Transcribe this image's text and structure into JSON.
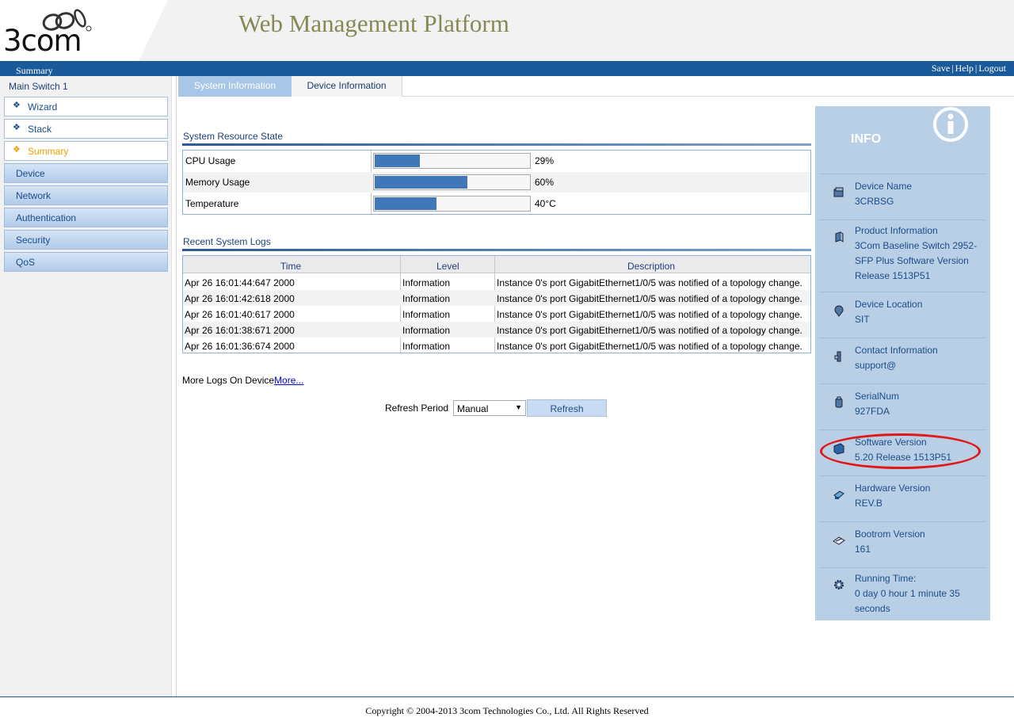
{
  "header": {
    "logo_text": "3com",
    "title": "Web Management Platform"
  },
  "topbar": {
    "breadcrumb": "Summary",
    "links": [
      "Save",
      "Help",
      "Logout"
    ]
  },
  "sidebar": {
    "title": "Main Switch 1",
    "items": [
      {
        "label": "Wizard",
        "style": "light"
      },
      {
        "label": "Stack",
        "style": "light"
      },
      {
        "label": "Summary",
        "style": "light",
        "active": true
      },
      {
        "label": "Device",
        "style": "blue"
      },
      {
        "label": "Network",
        "style": "blue"
      },
      {
        "label": "Authentication",
        "style": "blue"
      },
      {
        "label": "Security",
        "style": "blue"
      },
      {
        "label": "QoS",
        "style": "blue"
      }
    ]
  },
  "tabs": [
    {
      "label": "System Information",
      "active": true
    },
    {
      "label": "Device Information",
      "active": false
    }
  ],
  "resource": {
    "title": "System Resource State",
    "rows": [
      {
        "label": "CPU Usage",
        "value": "29%",
        "percent": 29
      },
      {
        "label": "Memory Usage",
        "value": "60%",
        "percent": 60
      },
      {
        "label": "Temperature",
        "value": "40°C",
        "percent": 40
      }
    ]
  },
  "logs": {
    "title": "Recent System Logs",
    "columns": [
      "Time",
      "Level",
      "Description"
    ],
    "rows": [
      [
        "Apr 26 16:01:44:647 2000",
        "Information",
        "Instance 0's port GigabitEthernet1/0/5 was notified of a topology change."
      ],
      [
        "Apr 26 16:01:42:618 2000",
        "Information",
        "Instance 0's port GigabitEthernet1/0/5 was notified of a topology change."
      ],
      [
        "Apr 26 16:01:40:617 2000",
        "Information",
        "Instance 0's port GigabitEthernet1/0/5 was notified of a topology change."
      ],
      [
        "Apr 26 16:01:38:671 2000",
        "Information",
        "Instance 0's port GigabitEthernet1/0/5 was notified of a topology change."
      ],
      [
        "Apr 26 16:01:36:674 2000",
        "Information",
        "Instance 0's port GigabitEthernet1/0/5 was notified of a topology change."
      ]
    ],
    "more_prefix": "More Logs On Device",
    "more_link": "More..."
  },
  "refresh": {
    "label": "Refresh Period",
    "selected": "Manual",
    "button": "Refresh"
  },
  "info": {
    "title": "INFO",
    "items": [
      {
        "key": "Device Name",
        "value": "3CRBSG",
        "icon": "device-name-icon"
      },
      {
        "key": "Product Information",
        "value": "3Com Baseline Switch 2952-SFP Plus Software Version Release 1513P51",
        "icon": "product-info-icon"
      },
      {
        "key": "Device Location",
        "value": "SIT",
        "icon": "location-icon"
      },
      {
        "key": "Contact Information",
        "value": "support@",
        "icon": "contact-icon"
      },
      {
        "key": "SerialNum",
        "value": "927FDA",
        "icon": "serial-icon"
      },
      {
        "key": "Software Version",
        "value": "5.20 Release 1513P51",
        "icon": "software-icon"
      },
      {
        "key": "Hardware Version",
        "value": "REV.B",
        "icon": "hardware-icon"
      },
      {
        "key": "Bootrom Version",
        "value": "161",
        "icon": "bootrom-icon"
      },
      {
        "key": "Running Time:",
        "value": "0 day 0 hour 1 minute 35 seconds",
        "icon": "gear-icon"
      }
    ]
  },
  "footer": {
    "copyright": "Copyright © 2004-2013 3com Technologies Co., Ltd. All Rights Reserved"
  },
  "colors": {
    "accent": "#1b5a9a",
    "info_bg": "#b9cfe6",
    "bar_fill": "#3f77b8",
    "title_olive": "#868955",
    "active_orange": "#f0a000",
    "highlight_red": "#e01818"
  }
}
